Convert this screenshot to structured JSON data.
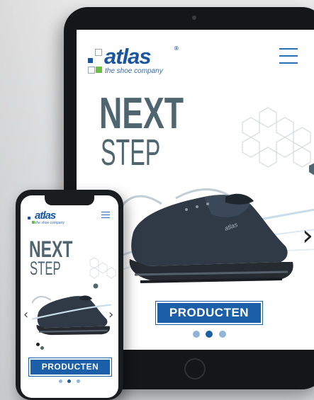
{
  "brand": {
    "name": "atlas",
    "tagline": "the shoe company",
    "registered": "®",
    "colors": {
      "primary": "#1a5fa8",
      "green": "#6cbe45",
      "headline": "#4f6670"
    }
  },
  "hero": {
    "line1": "NEXT",
    "line2": "STEP",
    "cta_label": "PRODUCTEN",
    "slides_total": 3,
    "slide_active": 2
  },
  "navigation": {
    "menu_icon": "hamburger-menu-icon",
    "prev_icon": "chevron-left-icon",
    "next_icon": "chevron-right-icon",
    "prev_glyph": "‹",
    "next_glyph": "›"
  }
}
